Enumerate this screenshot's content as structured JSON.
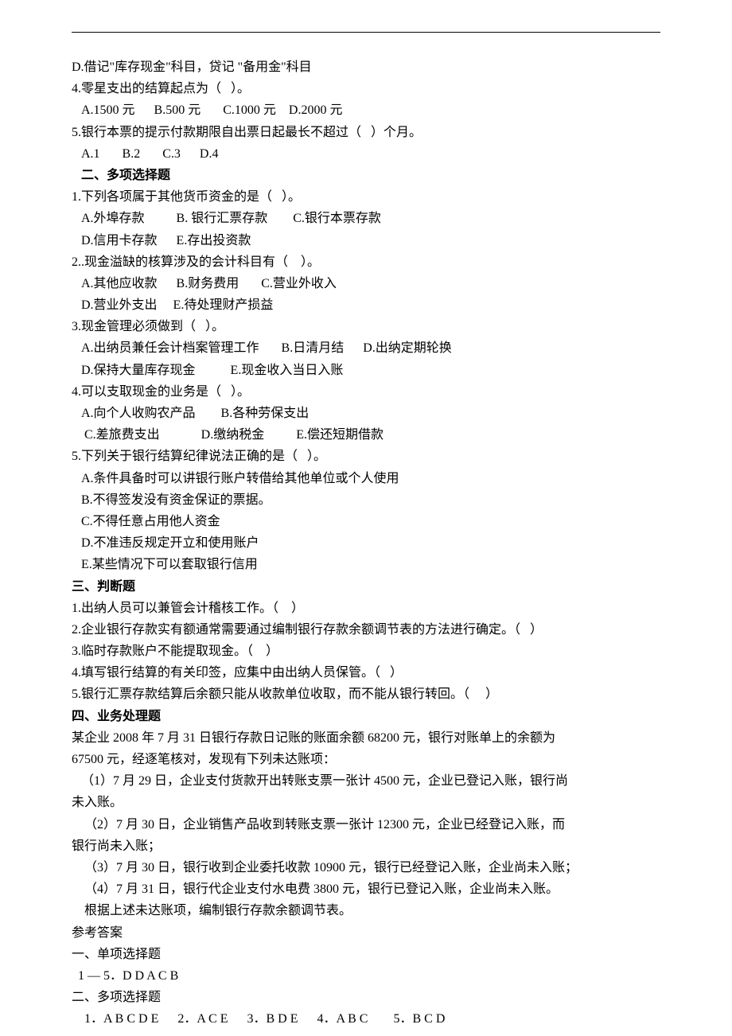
{
  "lines": {
    "l1": "D.借记\"库存现金\"科目，贷记 \"备用金\"科目",
    "l2": "4.零星支出的结算起点为（   ）。",
    "l3": "   A.1500 元      B.500 元       C.1000 元    D.2000 元",
    "l4": "5.银行本票的提示付款期限自出票日起最长不超过（   ）个月。",
    "l5": "   A.1       B.2       C.3      D.4",
    "sec2": "   二、多项选择题",
    "m1": "1.下列各项属于其他货币资金的是（   ）。",
    "m1a": "   A.外埠存款          B. 银行汇票存款        C.银行本票存款",
    "m1b": "   D.信用卡存款      E.存出投资款",
    "m2": "2..现金溢缺的核算涉及的会计科目有（    ）。",
    "m2a": "   A.其他应收款      B.财务费用       C.营业外收入",
    "m2b": "   D.营业外支出     E.待处理财产损益",
    "m3": "3.现金管理必须做到（   ）。",
    "m3a": "   A.出纳员兼任会计档案管理工作       B.日清月结      D.出纳定期轮换",
    "m3b": "   D.保持大量库存现金           E.现金收入当日入账",
    "m4": "4.可以支取现金的业务是（   ）。",
    "m4a": "   A.向个人收购农产品        B.各种劳保支出",
    "m4b": "    C.差旅费支出             D.缴纳税金          E.偿还短期借款",
    "m5": "5.下列关于银行结算纪律说法正确的是（   ）。",
    "m5a": "   A.条件具备时可以讲银行账户转借给其他单位或个人使用",
    "m5b": "   B.不得签发没有资金保证的票据。",
    "m5c": "   C.不得任意占用他人资金",
    "m5d": "   D.不准违反规定开立和使用账户",
    "m5e": "   E.某些情况下可以套取银行信用",
    "sec3": "三、判断题",
    "j1": "1.出纳人员可以兼管会计稽核工作。（    ）",
    "j2": "2.企业银行存款实有额通常需要通过编制银行存款余额调节表的方法进行确定。（   ）",
    "j3": "3.临时存款账户不能提取现金。（    ）",
    "j4": "4.填写银行结算的有关印签，应集中由出纳人员保管。（   ）",
    "j5": "5.银行汇票存款结算后余额只能从收款单位收取，而不能从银行转回。（     ）",
    "sec4": "四、业务处理题",
    "b1": "某企业 2008 年 7 月 31 日银行存款日记账的账面余额 68200 元，银行对账单上的余额为",
    "b2": "67500 元，经逐笔核对，发现有下列未达账项：",
    "b3": "   （1）7 月 29 日，企业支付货款开出转账支票一张计 4500 元，企业已登记入账，银行尚",
    "b4": "未入账。",
    "b5": "    （2）7 月 30 日，企业销售产品收到转账支票一张计 12300 元，企业已经登记入账，而",
    "b6": "银行尚未入账；",
    "b7": "    （3）7 月 30 日，银行收到企业委托收款 10900 元，银行已经登记入账，企业尚未入账；",
    "b8": "    （4）7 月 31 日，银行代企业支付水电费 3800 元，银行已登记入账，企业尚未入账。",
    "b9": "    根据上述未达账项，编制银行存款余额调节表。",
    "ans": "参考答案",
    "a1": "一、单项选择题",
    "a2": "  1 — 5．D D A C B",
    "a3": "二、多项选择题",
    "a4": "    1．A B C D E      2．A C E      3．B D E      4．A B C        5．B C D"
  }
}
